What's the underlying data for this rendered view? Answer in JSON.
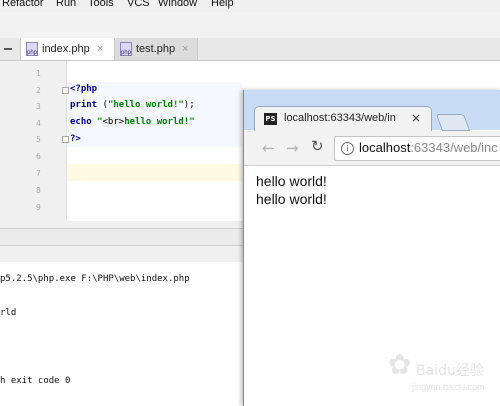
{
  "menubar": {
    "items": [
      {
        "label": "Refactor",
        "u": "R"
      },
      {
        "label": "Run",
        "u": "u"
      },
      {
        "label": "Tools",
        "u": "T"
      },
      {
        "label": "VCS",
        "u": "S"
      },
      {
        "label": "Window",
        "u": "W"
      },
      {
        "label": "Help",
        "u": "H"
      }
    ]
  },
  "editor_tabs": [
    {
      "label": "index.php",
      "active": true,
      "icon": "php-file-icon"
    },
    {
      "label": "test.php",
      "active": false,
      "icon": "php-file-icon"
    }
  ],
  "editor": {
    "line_numbers": [
      "1",
      "2",
      "3",
      "4",
      "5",
      "6",
      "7",
      "8",
      "9"
    ],
    "code": [
      "",
      "<?php",
      "print (\"hello world!\");",
      "echo \"<br>hello world!\"",
      "?>",
      "",
      "",
      "",
      ""
    ]
  },
  "console": {
    "lines": [
      "p5.2.5\\php.exe F:\\PHP\\web\\index.php",
      "",
      "rld",
      "",
      "",
      "",
      "h exit code 0"
    ]
  },
  "browser": {
    "tab_title": "localhost:63343/web/in",
    "tab_icon": "phpstorm-icon",
    "close": "×",
    "url_host": "localhost",
    "url_rest": ":63343/web/inc",
    "back": "←",
    "forward": "→",
    "reload": "↻",
    "info": "i",
    "output": [
      "hello world!",
      "hello world!"
    ]
  },
  "watermark": {
    "main": "Baidu经验",
    "sub": "jingyan.baidu.com"
  },
  "colors": {
    "keyword": "#000080",
    "string": "#008000",
    "browser_frame": "#c9dcf6"
  }
}
